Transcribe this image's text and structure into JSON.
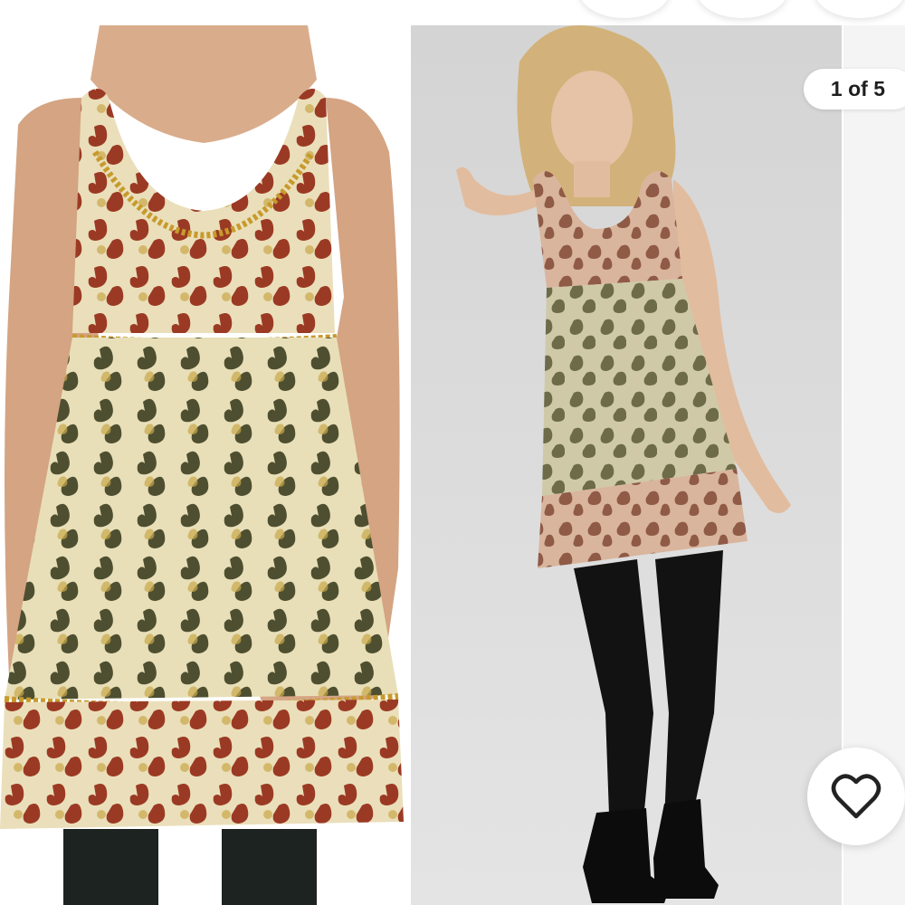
{
  "listing": {
    "photo_counter": "1 of 5",
    "photos": [
      {
        "name": "front-view-dress"
      },
      {
        "name": "model-full-length"
      }
    ]
  },
  "icons": {
    "like": "heart-outline-icon"
  },
  "colors": {
    "dress_base": "#e6dcb4",
    "motif_red": "#9b3a24",
    "motif_green": "#4e4f30",
    "trim_gold": "#c79a2c",
    "tights": "#111111",
    "background_right": "#d9d9d9"
  }
}
